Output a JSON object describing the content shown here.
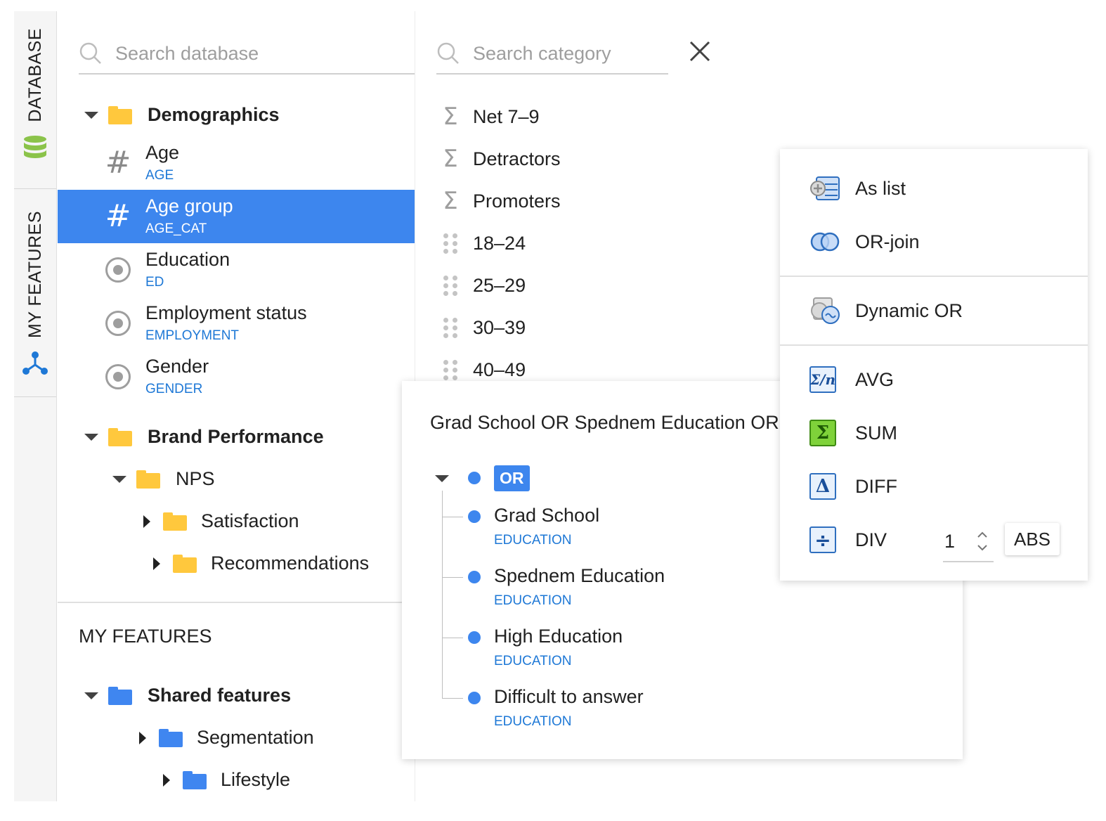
{
  "rail": {
    "database_tab": "DATABASE",
    "my_features_tab": "MY FEATURES"
  },
  "database": {
    "search_placeholder": "Search database",
    "groups": [
      {
        "title": "Demographics",
        "items": [
          {
            "name": "Age",
            "code": "AGE",
            "icon": "hash-icon"
          },
          {
            "name": "Age group",
            "code": "AGE_CAT",
            "icon": "hash-icon",
            "selected": true
          },
          {
            "name": "Education",
            "code": "ED",
            "icon": "radio-icon"
          },
          {
            "name": "Employment status",
            "code": "EMPLOYMENT",
            "icon": "radio-icon"
          },
          {
            "name": "Gender",
            "code": "GENDER",
            "icon": "radio-icon"
          }
        ]
      },
      {
        "title": "Brand Performance",
        "children": [
          {
            "name": "NPS",
            "children": [
              "Satisfaction",
              "Recommendations"
            ]
          }
        ]
      }
    ]
  },
  "my_features": {
    "section_title": "MY FEATURES",
    "group_title": "Shared features",
    "children": [
      "Segmentation",
      "Lifestyle"
    ]
  },
  "category": {
    "search_placeholder": "Search category",
    "items": [
      {
        "label": "Net 7–9",
        "icon": "sigma-icon"
      },
      {
        "label": "Detractors",
        "icon": "sigma-icon"
      },
      {
        "label": "Promoters",
        "icon": "sigma-icon"
      },
      {
        "label": "18–24",
        "icon": "drag-handle-icon"
      },
      {
        "label": "25–29",
        "icon": "drag-handle-icon"
      },
      {
        "label": "30–39",
        "icon": "drag-handle-icon"
      },
      {
        "label": "40–49",
        "icon": "drag-handle-icon"
      }
    ]
  },
  "expression": {
    "title": "Grad School OR Spednem Education OR",
    "operator": "OR",
    "terms": [
      {
        "name": "Grad School",
        "code": "EDUCATION"
      },
      {
        "name": "Spednem Education",
        "code": "EDUCATION"
      },
      {
        "name": "High Education",
        "code": "EDUCATION"
      },
      {
        "name": "Difficult to answer",
        "code": "EDUCATION"
      }
    ]
  },
  "menu": {
    "as_list": "As list",
    "or_join": "OR-join",
    "dynamic_or": "Dynamic OR",
    "avg": "AVG",
    "sum": "SUM",
    "diff": "DIFF",
    "div": "DIV",
    "div_value": "1",
    "abs": "ABS"
  },
  "colors": {
    "accent": "#3d86ee",
    "code_text": "#1e78d6",
    "folder_yellow": "#ffc83d",
    "folder_blue": "#3f86f0"
  }
}
